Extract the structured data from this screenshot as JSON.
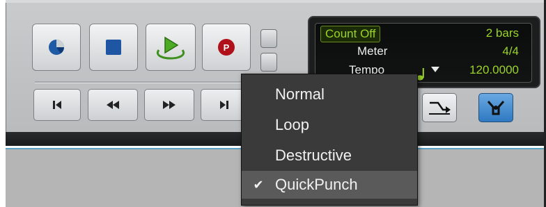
{
  "counter": {
    "count_off": "Count Off",
    "bars": "2 bars",
    "meter_label": "Meter",
    "meter_value": "4/4",
    "tempo_label": "Tempo",
    "tempo_value": "120.0000"
  },
  "menu": {
    "items": [
      {
        "label": "Normal",
        "checked": false
      },
      {
        "label": "Loop",
        "checked": false
      },
      {
        "label": "Destructive",
        "checked": false
      },
      {
        "label": "QuickPunch",
        "checked": true
      }
    ],
    "check_glyph": "✔"
  },
  "icons": {
    "online": "online-icon",
    "stop": "stop-icon",
    "play_loop": "loop-play-icon",
    "record": "record-icon",
    "rtz": "return-to-zero-icon",
    "rewind": "rewind-icon",
    "fast_forward": "fast-forward-icon",
    "go_to_end": "go-to-end-icon",
    "tempo_dropdown": "chevron-down-icon",
    "merge": "merge-icon",
    "link": "link-icon"
  },
  "colors": {
    "counter_green": "#9bd32a",
    "link_blue": "#2f79c1",
    "menu_bg": "#3a3a3a"
  }
}
